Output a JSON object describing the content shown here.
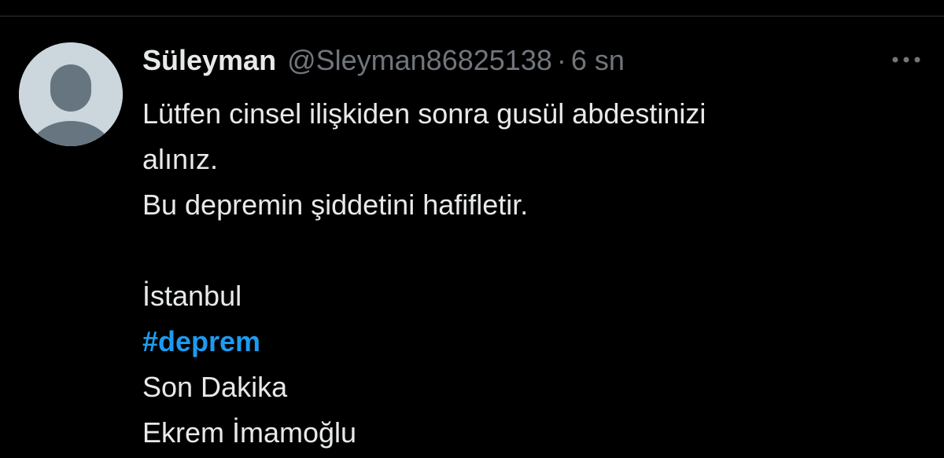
{
  "tweet": {
    "author": {
      "display_name": "Süleyman",
      "handle": "@Sleyman86825138",
      "avatar_icon": "default-profile-icon"
    },
    "separator": "·",
    "timestamp": "6 sn",
    "more_icon": "more-horizontal-icon",
    "body": {
      "line_1": "Lütfen cinsel ilişkiden sonra gusül abdestinizi",
      "line_2": "alınız.",
      "line_3": "Bu depremin şiddetini hafifletir.",
      "line_5": "İstanbul",
      "hashtag": "#deprem",
      "line_7": "Son Dakika",
      "line_8": "Ekrem İmamoğlu"
    }
  },
  "colors": {
    "background": "#000000",
    "text_primary": "#e7e9ea",
    "text_secondary": "#71767b",
    "link": "#1d9bf0",
    "avatar_bg": "#ccd6dd",
    "avatar_figure": "#66757f"
  }
}
